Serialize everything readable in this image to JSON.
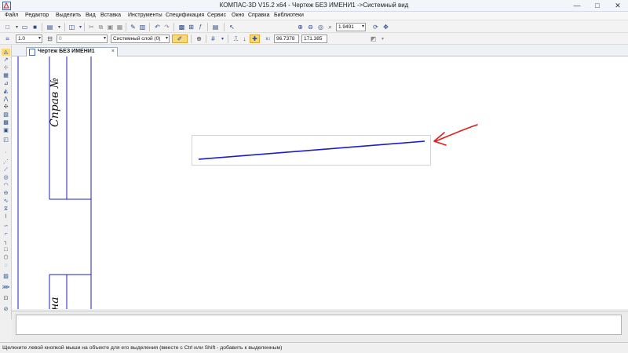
{
  "window": {
    "title": "КОМПАС-3D V15.2  x64 - Чертеж БЕЗ ИМЕНИ1 ->Системный вид",
    "minimize": "—",
    "maximize": "□",
    "close": "✕"
  },
  "menu": {
    "items": [
      "Файл",
      "Редактор",
      "Выделить",
      "Вид",
      "Вставка",
      "Инструменты",
      "Спецификация",
      "Сервис",
      "Окно",
      "Справка",
      "Библиотеки"
    ]
  },
  "toolbar1": {
    "zoom_value": "1.9491"
  },
  "toolbar2": {
    "line_style": "1.0",
    "layer_number": "0",
    "layer_name": "Системный слой (0)",
    "coord_x": "96.7378",
    "coord_y": "171.385"
  },
  "document_tab": {
    "title": "Чертеж БЕЗ ИМЕНИ1",
    "close": "×"
  },
  "drawing": {
    "stamp_top": "Справ №",
    "stamp_bottom": "на",
    "line_color": "#1c1cc8",
    "annotation_color": "#e01d1d"
  },
  "statusbar": {
    "hint": "Щелкните левой кнопкой мыши на объекте для его выделения (вместе с Ctrl или Shift - добавить к выделенным)"
  }
}
